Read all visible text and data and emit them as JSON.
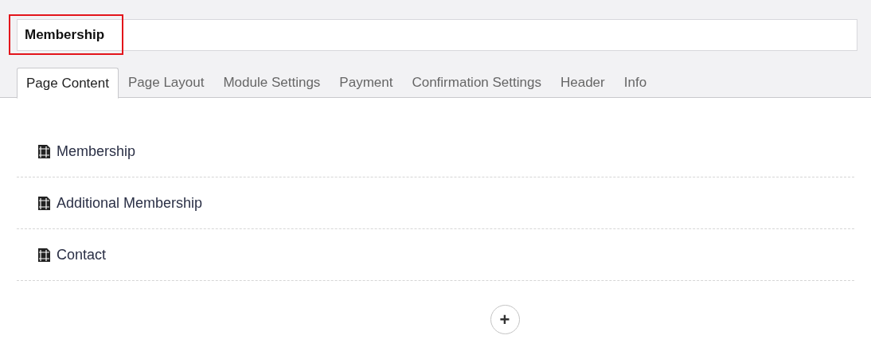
{
  "title_field": {
    "value": "Membership",
    "highlighted": true
  },
  "tabs": [
    {
      "label": "Page Content",
      "selected": true
    },
    {
      "label": "Page Layout",
      "selected": false
    },
    {
      "label": "Module Settings",
      "selected": false
    },
    {
      "label": "Payment",
      "selected": false
    },
    {
      "label": "Confirmation Settings",
      "selected": false
    },
    {
      "label": "Header",
      "selected": false
    },
    {
      "label": "Info",
      "selected": false
    }
  ],
  "pages": [
    {
      "label": "Membership"
    },
    {
      "label": "Additional Membership"
    },
    {
      "label": "Contact"
    }
  ],
  "add_button": "+"
}
